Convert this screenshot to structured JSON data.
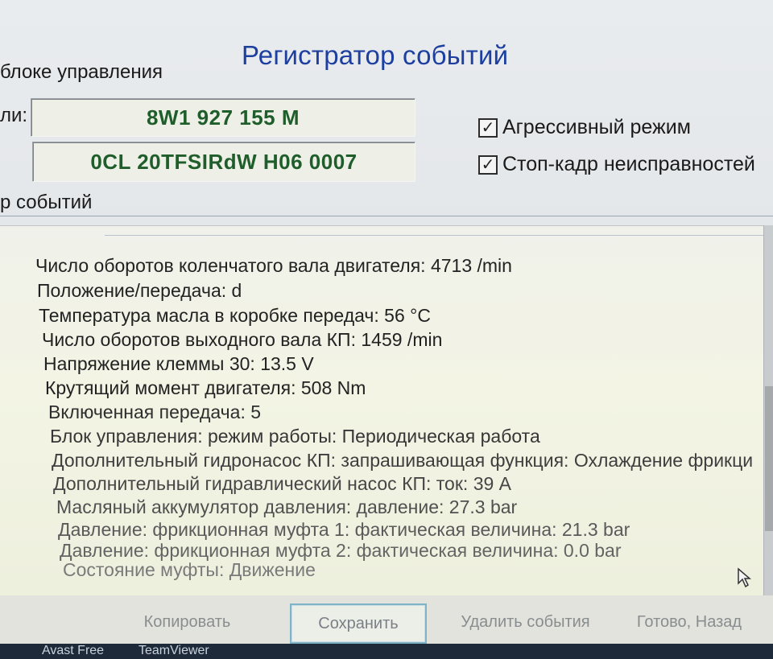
{
  "window": {
    "title": "Регистратор событий",
    "group_label": "блоке управления",
    "part_label": "ли:",
    "part_number": "8W1 927 155 M",
    "software": "0CL 20TFSIRdW H06 0007",
    "options": [
      {
        "label": "Агрессивный режим",
        "checked": true,
        "mark": "✓"
      },
      {
        "label": "Стоп-кадр неисправностей",
        "checked": true,
        "mark": "✓"
      }
    ],
    "events_label": "р событий"
  },
  "log": {
    "lines": [
      "Число оборотов коленчатого вала двигателя: 4713 /min",
      "Положение/передача: d",
      "Температура масла в коробке передач: 56 °C",
      "Число оборотов выходного вала КП: 1459 /min",
      "Напряжение клеммы 30: 13.5 V",
      "Крутящий момент двигателя: 508 Nm",
      "Включенная передача: 5",
      "Блок управления: режим работы: Периодическая работа",
      "Дополнительный гидронасос КП: запрашивающая функция: Охлаждение фрикци",
      "Дополнительный гидравлический насос КП: ток: 39 A",
      "Масляный аккумулятор давления: давление: 27.3 bar",
      "Давление: фрикционная муфта 1: фактическая величина: 21.3 bar",
      "Давление: фрикционная муфта 2: фактическая величина: 0.0 bar",
      "Состояние муфты: Движение"
    ]
  },
  "buttons": {
    "copy": "Копировать",
    "save": "Сохранить",
    "delete": "Удалить события",
    "done": "Готово, Назад"
  },
  "taskbar": {
    "item1": "Avast Free",
    "item2": "TeamViewer"
  },
  "colors": {
    "title": "#1c3fa0",
    "field_text": "#1f5e2a",
    "accent_border": "#7fb3c8"
  }
}
